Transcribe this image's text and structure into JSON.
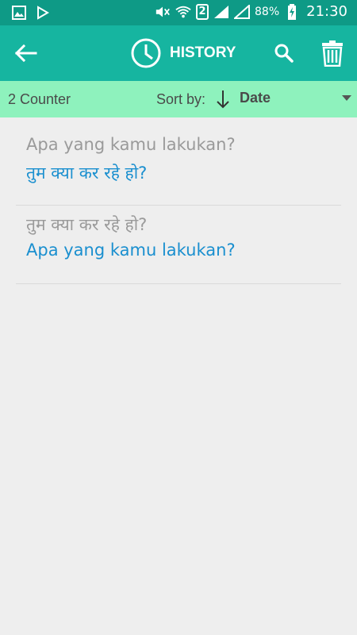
{
  "status_bar": {
    "icons_left": [
      "image-icon",
      "play-store-icon"
    ],
    "icons_right": [
      "mute-icon",
      "wifi-icon",
      "sim-icon",
      "signal-icon",
      "signal-empty-icon",
      "battery-icon"
    ],
    "sim_number": "2",
    "battery": "88%",
    "time": "21:30"
  },
  "app_bar": {
    "title": "HISTORY",
    "back_icon": "arrow-left-icon",
    "title_icon": "clock-icon",
    "search_icon": "search-icon",
    "delete_icon": "trash-icon"
  },
  "sort_bar": {
    "counter": "2 Counter",
    "sort_label": "Sort by:",
    "sort_direction_icon": "arrow-down-icon",
    "sort_value": "Date"
  },
  "history": [
    {
      "source": "Apa yang kamu lakukan?",
      "translation": "तुम क्या कर रहे हो?"
    },
    {
      "source": "तुम क्या कर रहे हो?",
      "translation": "Apa yang kamu lakukan?"
    }
  ],
  "colors": {
    "status_bar": "#0e9a86",
    "app_bar": "#16b5a0",
    "sort_bar": "#8ef2bd",
    "background": "#eeeeee",
    "source_text": "#9a9a9a",
    "translation_text": "#1a8fcf"
  }
}
